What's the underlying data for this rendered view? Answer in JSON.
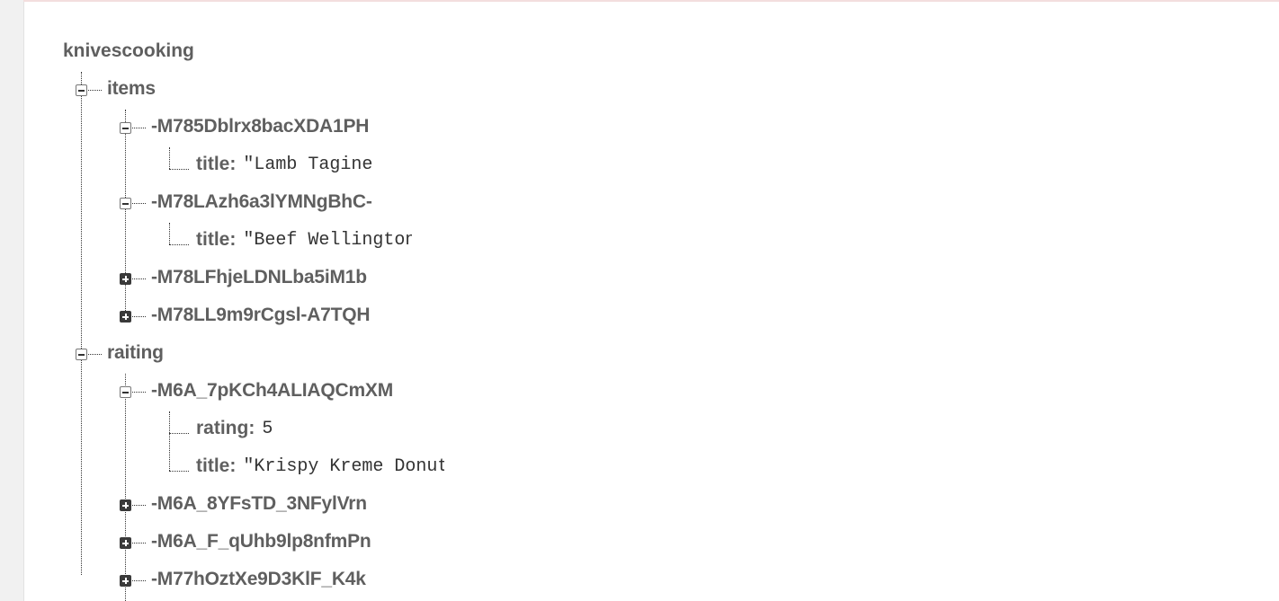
{
  "tree": {
    "root": "knivescooking",
    "items": {
      "key": "items",
      "children": [
        {
          "key": "-M785Dblrx8bacXDA1PH",
          "title_key": "title:",
          "title_value": "\"Lamb Tagine"
        },
        {
          "key": "-M78LAzh6a3lYMNgBhC-",
          "title_key": "title:",
          "title_value": "\"Beef Wellington"
        },
        {
          "key": "-M78LFhjeLDNLba5iM1b"
        },
        {
          "key": "-M78LL9m9rCgsl-A7TQH"
        }
      ]
    },
    "raiting": {
      "key": "raiting",
      "children": [
        {
          "key": "-M6A_7pKCh4ALIAQCmXM",
          "rating_key": "rating:",
          "rating_value": "5",
          "title_key": "title:",
          "title_value": "\"Krispy Kreme Donuts"
        },
        {
          "key": "-M6A_8YFsTD_3NFylVrn"
        },
        {
          "key": "-M6A_F_qUhb9lp8nfmPn"
        },
        {
          "key": "-M77hOztXe9D3KlF_K4k"
        }
      ]
    }
  }
}
